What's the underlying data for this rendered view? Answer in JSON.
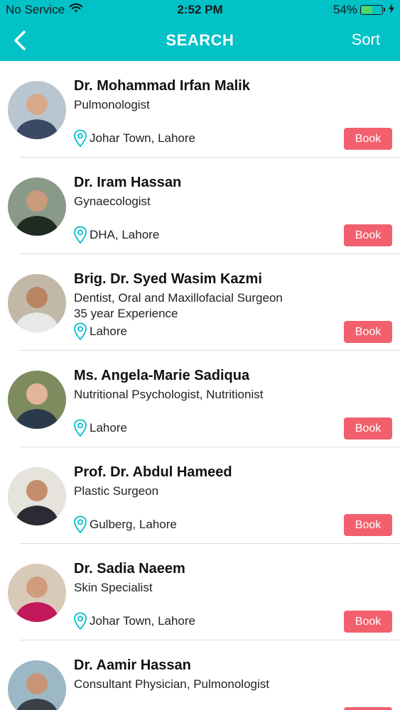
{
  "status_bar": {
    "carrier": "No Service",
    "time": "2:52 PM",
    "battery": "54%",
    "battery_level": 0.54,
    "icons": [
      "wifi-icon",
      "battery-icon",
      "charging-bolt-icon"
    ]
  },
  "nav": {
    "title": "SEARCH",
    "sort_label": "Sort",
    "back_icon": "chevron-left-icon",
    "color": "#00c2c7"
  },
  "book_color": "#f2606e",
  "doctors": [
    {
      "name": "Dr. Mohammad Irfan Malik",
      "specialty": "Pulmonologist",
      "experience": "",
      "location": "Johar Town, Lahore",
      "book_label": "Book"
    },
    {
      "name": "Dr. Iram Hassan",
      "specialty": "Gynaecologist",
      "experience": "",
      "location": "DHA, Lahore",
      "book_label": "Book"
    },
    {
      "name": "Brig. Dr. Syed Wasim Kazmi",
      "specialty": "Dentist, Oral and Maxillofacial Surgeon",
      "experience": "35 year Experience",
      "location": "Lahore",
      "book_label": "Book"
    },
    {
      "name": "Ms. Angela-Marie Sadiqua",
      "specialty": "Nutritional Psychologist, Nutritionist",
      "experience": "",
      "location": "Lahore",
      "book_label": "Book"
    },
    {
      "name": "Prof. Dr. Abdul Hameed",
      "specialty": "Plastic Surgeon",
      "experience": "",
      "location": "Gulberg, Lahore",
      "book_label": "Book"
    },
    {
      "name": "Dr. Sadia Naeem",
      "specialty": "Skin Specialist",
      "experience": "",
      "location": "Johar Town, Lahore",
      "book_label": "Book"
    },
    {
      "name": "Dr. Aamir Hassan",
      "specialty": "Consultant Physician, Pulmonologist",
      "experience": "",
      "location": "",
      "book_label": "Book"
    }
  ]
}
